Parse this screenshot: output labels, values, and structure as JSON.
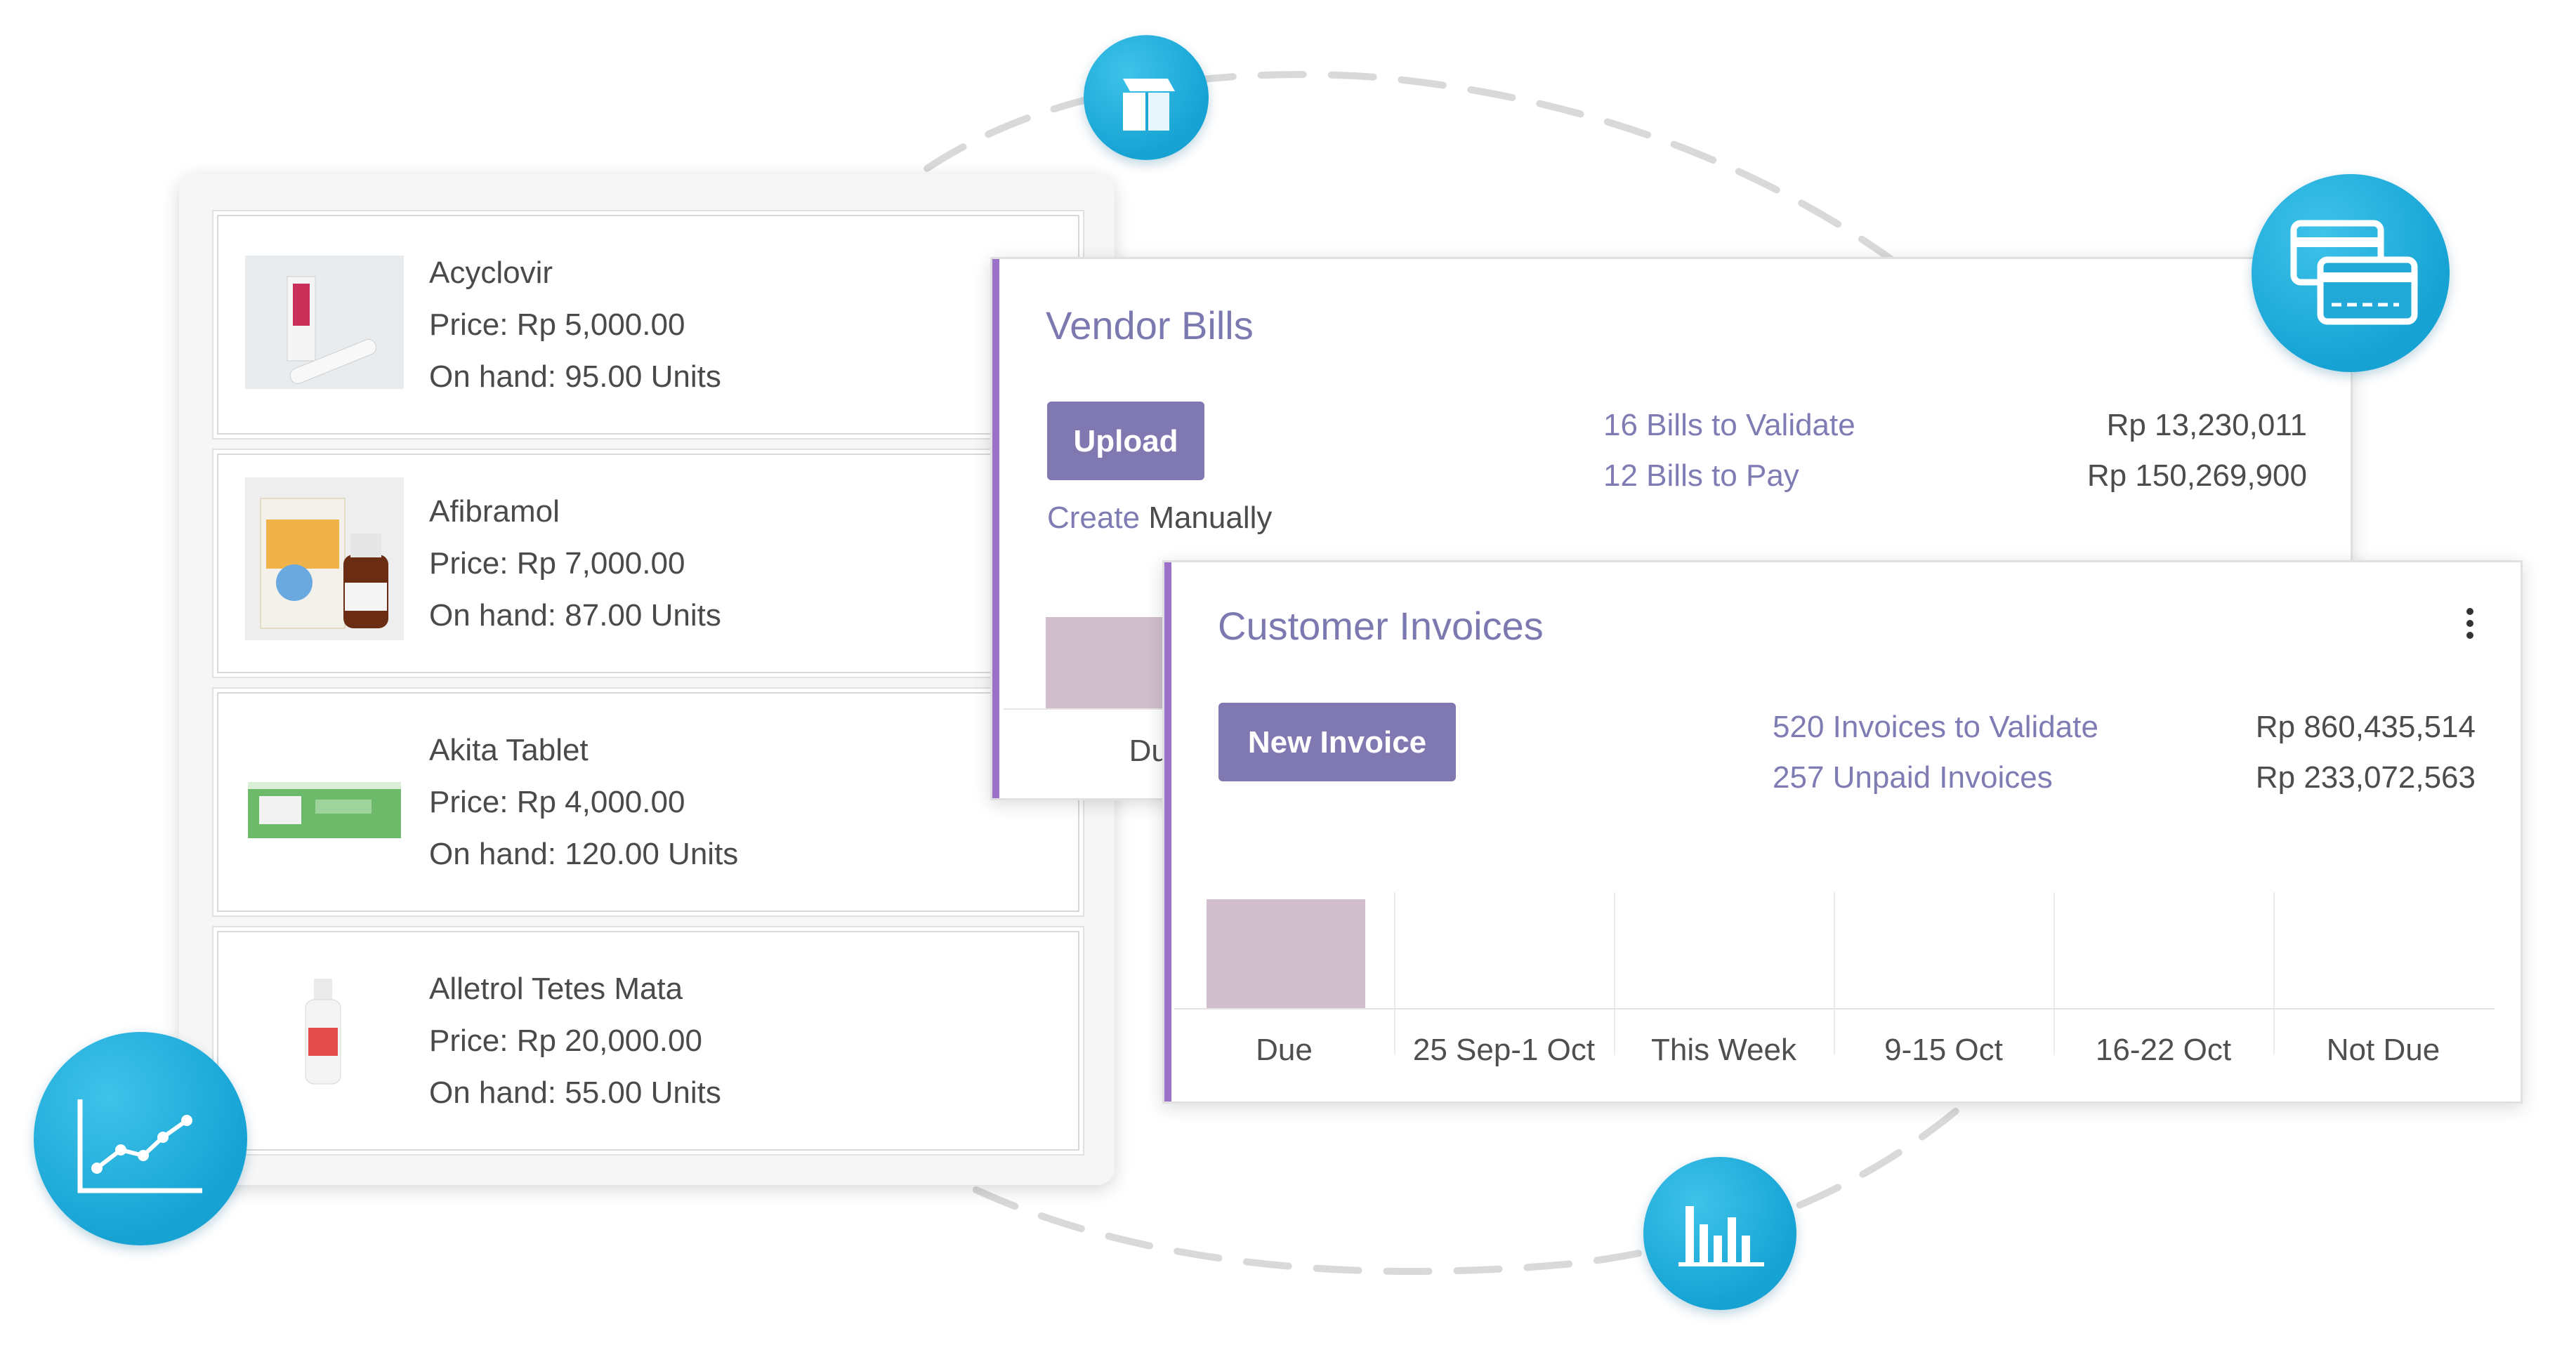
{
  "products": [
    {
      "name": "Acyclovir",
      "price": "Price: Rp 5,000.00",
      "on_hand": "On hand: 95.00 Units"
    },
    {
      "name": "Afibramol",
      "price": "Price: Rp 7,000.00",
      "on_hand": "On hand: 87.00 Units"
    },
    {
      "name": "Akita Tablet",
      "price": "Price: Rp 4,000.00",
      "on_hand": "On hand: 120.00 Units"
    },
    {
      "name": "Alletrol Tetes Mata",
      "price": "Price: Rp 20,000.00",
      "on_hand": "On hand: 55.00 Units"
    }
  ],
  "vendor_bills": {
    "title": "Vendor Bills",
    "upload_label": "Upload",
    "create_link": "Create",
    "create_suffix": "Manually",
    "stats": [
      {
        "label": "16 Bills to Validate",
        "amount": "Rp 13,230,011"
      },
      {
        "label": "12 Bills to Pay",
        "amount": "Rp 150,269,900"
      }
    ],
    "visible_bar_label": "Due"
  },
  "customer_invoices": {
    "title": "Customer Invoices",
    "new_invoice_label": "New Invoice",
    "stats": [
      {
        "label": "520 Invoices to Validate",
        "amount": "Rp 860,435,514"
      },
      {
        "label": "257 Unpaid Invoices",
        "amount": "Rp 233,072,563"
      }
    ],
    "chart_labels": [
      "Due",
      "25 Sep-1 Oct",
      "This Week",
      "9-15 Oct",
      "16-22 Oct",
      "Not Due"
    ]
  },
  "icons": [
    "box-icon",
    "credit-cards-icon",
    "line-chart-icon",
    "bar-chart-icon",
    "kebab-menu-icon"
  ],
  "colors": {
    "accent": "#8078b0",
    "link": "#7f7cb4",
    "stripe": "#9b72c7",
    "bar": "#d1bfcd",
    "icon_bg": "#1ea9d8"
  }
}
